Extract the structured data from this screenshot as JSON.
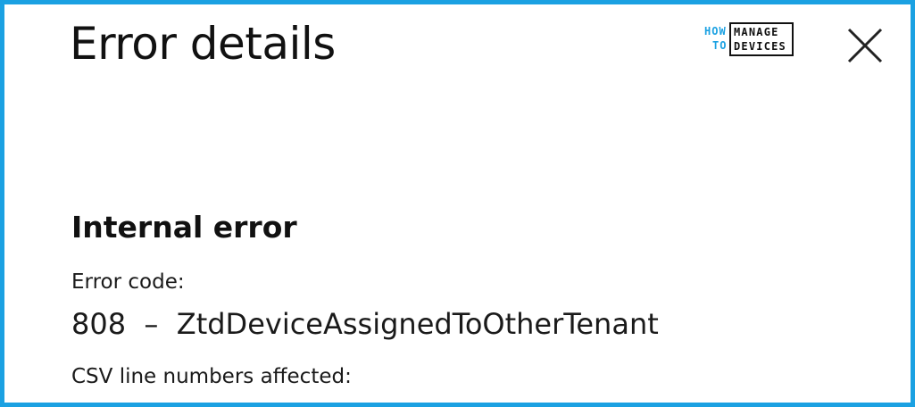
{
  "dialog": {
    "title": "Error details",
    "close_icon": "close-icon"
  },
  "logo": {
    "line1_small": "HOW",
    "line2_small": "TO",
    "line1_big": "MANAGE",
    "line2_big": "DEVICES"
  },
  "error": {
    "heading": "Internal error",
    "code_label": "Error code:",
    "code_number": "808",
    "separator": "–",
    "code_name": "ZtdDeviceAssignedToOtherTenant",
    "csv_label": "CSV line numbers affected:"
  },
  "colors": {
    "frame_border": "#1ba1e2",
    "logo_accent": "#1ba1e2",
    "text": "#111111"
  }
}
